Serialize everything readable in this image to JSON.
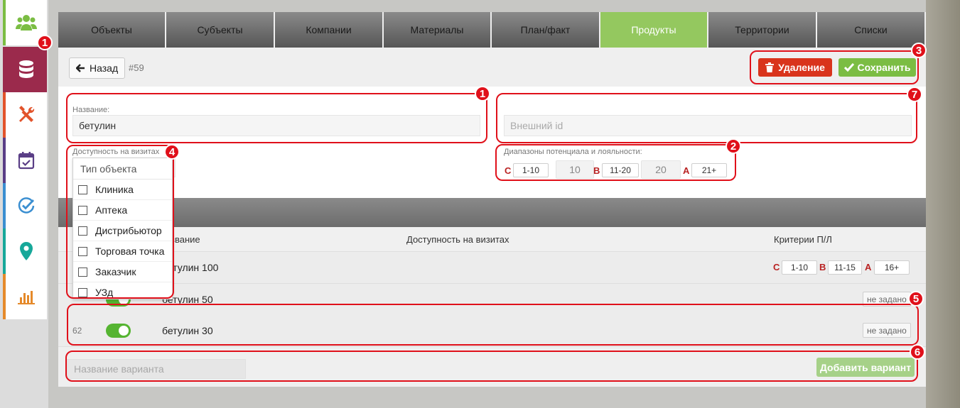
{
  "sidebar": {
    "items": [
      {
        "icon": "users-icon",
        "color": "#7bbd43"
      },
      {
        "icon": "database-icon",
        "color": "#9b2a4c"
      },
      {
        "icon": "tools-icon",
        "color": "#e2532b"
      },
      {
        "icon": "calendar-icon",
        "color": "#5a3e86"
      },
      {
        "icon": "check-circle-icon",
        "color": "#3b8fd1"
      },
      {
        "icon": "map-pin-icon",
        "color": "#17a89a"
      },
      {
        "icon": "bar-chart-icon",
        "color": "#e58a2b"
      }
    ]
  },
  "tabs": [
    {
      "label": "Объекты"
    },
    {
      "label": "Субъекты"
    },
    {
      "label": "Компании"
    },
    {
      "label": "Материалы"
    },
    {
      "label": "План/факт"
    },
    {
      "label": "Продукты"
    },
    {
      "label": "Территории"
    },
    {
      "label": "Списки"
    }
  ],
  "toolbar": {
    "back_label": "Назад",
    "record_id": "#59",
    "delete_label": "Удаление",
    "save_label": "Сохранить"
  },
  "form": {
    "name_label": "Название:",
    "name_value": "бетулин",
    "external_id_placeholder": "Внешний id",
    "availability_label": "Доступность на визитах",
    "ranges_label": "Диапазоны потенциала и лояльности:",
    "ranges": {
      "c_letter": "C",
      "c_range": "1-10",
      "c_threshold": "10",
      "b_letter": "B",
      "b_range": "11-20",
      "b_threshold": "20",
      "a_letter": "A",
      "a_range": "21+"
    }
  },
  "object_type_dropdown": {
    "header": "Тип объекта",
    "options": [
      {
        "label": "Клиника",
        "checked": false
      },
      {
        "label": "Аптека",
        "checked": false
      },
      {
        "label": "Дистрибьютор",
        "checked": false
      },
      {
        "label": "Торговая точка",
        "checked": false
      },
      {
        "label": "Заказчик",
        "checked": false
      },
      {
        "label": "УЗд",
        "checked": false
      }
    ]
  },
  "variants_table": {
    "columns": [
      "Название",
      "Доступность на визитах",
      "Критерии П/Л"
    ],
    "column_name_partial": "звание",
    "rows": [
      {
        "id": "",
        "name": "бетулин 100",
        "criteria": {
          "c": "C",
          "c_range": "1-10",
          "b": "B",
          "b_range": "11-15",
          "a": "A",
          "a_range": "16+"
        }
      },
      {
        "id": "",
        "name": "бетулин 50",
        "criteria_text": "не задано"
      },
      {
        "id": "62",
        "name": "бетулин 30",
        "criteria_text": "не задано"
      }
    ]
  },
  "add_variant": {
    "placeholder": "Название варианта",
    "button_label": "Добавить вариант"
  },
  "annotations": [
    "1",
    "1",
    "2",
    "3",
    "4",
    "5",
    "6",
    "7"
  ],
  "colors": {
    "accent_green": "#94c85f",
    "delete_red": "#d9341c",
    "save_green": "#7bbd43",
    "annotation_red": "#e0101a",
    "range_letter": "#b92222"
  }
}
